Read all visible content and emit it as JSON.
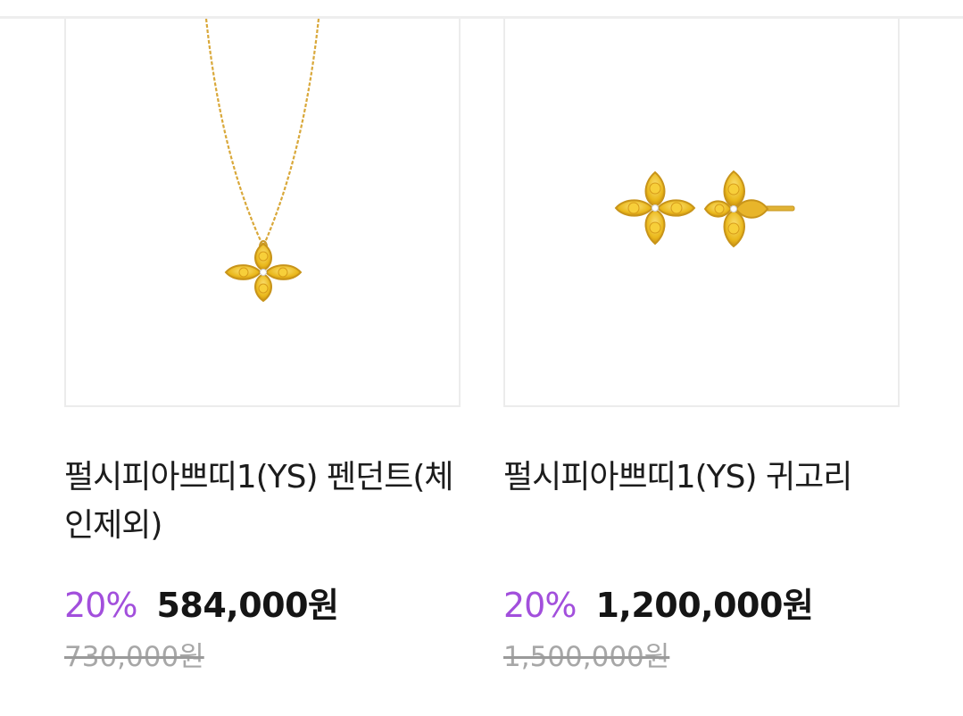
{
  "products": [
    {
      "title": "펄시피아쁘띠1(YS) 펜던트(체인제외)",
      "discount": "20%",
      "sale_price": "584,000원",
      "original_price": "730,000원",
      "image_icon": "pendant-necklace-image"
    },
    {
      "title": "펄시피아쁘띠1(YS) 귀고리",
      "discount": "20%",
      "sale_price": "1,200,000원",
      "original_price": "1,500,000원",
      "image_icon": "stud-earrings-image"
    }
  ],
  "colors": {
    "accent": "#a24fdc",
    "gold": "#e2b324",
    "stone": "#f2c21b"
  }
}
